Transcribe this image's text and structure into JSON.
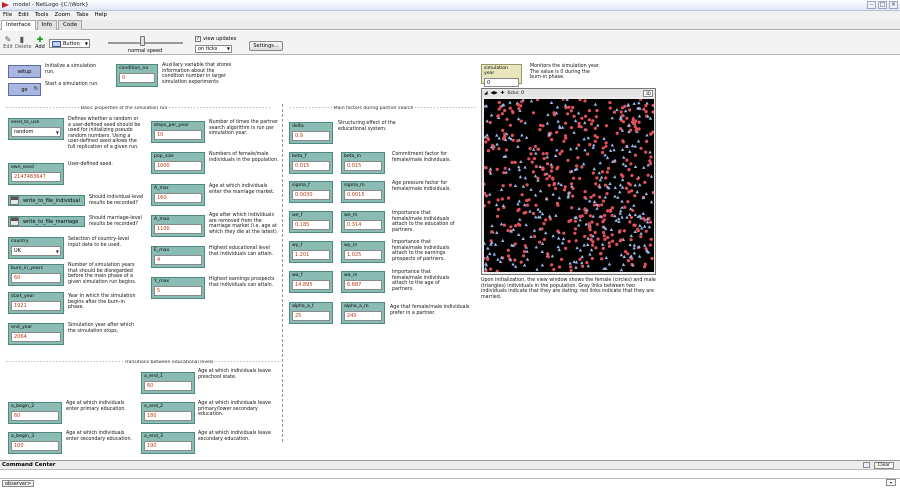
{
  "window": {
    "title": "model - NetLogo {C:\\Work}"
  },
  "menu": [
    "File",
    "Edit",
    "Tools",
    "Zoom",
    "Tabs",
    "Help"
  ],
  "tabs": [
    "Interface",
    "Info",
    "Code"
  ],
  "toolbar": {
    "edit": "Edit",
    "delete": "Delete",
    "add": "Add",
    "widget_type": "Button",
    "speed_label": "normal speed",
    "speed_level": 0.45,
    "view_updates": "view updates",
    "update_mode": "on ticks",
    "settings": "Settings..."
  },
  "buttons": {
    "setup": "setup",
    "go": "go"
  },
  "notes": {
    "setup": "Initialize a simulation run.",
    "go": "Start a simulation run.",
    "condition_no": "Auxiliary variable that stores information about the condition number in larger simulation experiments",
    "seed_to_use": "Defines whether a random or a user-defined seed should be used for initializing pseudo random numbers. Using a user-defined seed allows the full replication of a given run.",
    "own_seed": "User-defined seed.",
    "write_individual": "Should individual-level results be recorded?",
    "write_marriage": "Should marriage-level results be recorded?",
    "country": "Selection of country-level input data to be used.",
    "burn_in_years": "Number of simulation years that should be disregarded before the main phase of a given simulation run begins.",
    "start_year": "Year in which the simulation begins after the burn-in phase.",
    "end_year": "Simulation year after which the simulation stops.",
    "steps_per_year": "Number of times the partner search algorithm is run per simulation year.",
    "pop_size": "Numbers of female/male individuals in the population.",
    "A_mar": "Age at which individuals enter the marriage market.",
    "A_max": "Age after which individuals are removed from the marriage market (i.e. age at which they die at the latest).",
    "E_max": "Highest educational level that individuals can attain.",
    "Y_max": "Highest earnings prospects that individuals can attain.",
    "delta": "Structuring effect of the educational system.",
    "beta": "Commitment factor for female/male individuals.",
    "sigma": "Age pressure factor for female/male individuals.",
    "wa": "Importance that female/male individuals attach to the education of partners.",
    "wy": "Importance that female/male individuals attach to the earnings prospects of partners.",
    "wa2": "Importance that female/male individuals attach to the age of partners.",
    "alpha": "Age that female/male individuals prefer in a partner.",
    "simulation_year": "Monitors the simulation year. The value is 0 during the burn-in phase.",
    "view": "Upon initialization, the view window shows the female (circles) and male (triangles) individuals in the population. Gray links between two individuals indicate that they are dating; red links indicate that they are married.",
    "a_end_1": "Age at which individuals leave preschool state.",
    "a_begin_2": "Age at which individuals enter primary education.",
    "a_end_2": "Age at which individuals leave primary/lower secondary education.",
    "a_begin_3": "Age at which individuals enter secondary education.",
    "a_end_3": "Age at which individuals leave secondary education."
  },
  "sections": {
    "basic": "Basic properties of the simulation run",
    "partner": "Main factors during partner search",
    "transitions": "Transitions between educational levels"
  },
  "widgets": {
    "condition_no": {
      "label": "condition_no",
      "value": "0"
    },
    "seed_to_use": {
      "label": "seed_to_use",
      "value": "random"
    },
    "own_seed": {
      "label": "own_seed",
      "value": "2147483647"
    },
    "write_individual": {
      "label": "write_to_file_individual",
      "on": "On",
      "off": "Off"
    },
    "write_marriage": {
      "label": "write_to_file_marriage",
      "on": "On",
      "off": "Off"
    },
    "country": {
      "label": "country",
      "value": "UK"
    },
    "burn_in_years": {
      "label": "burn_in_years",
      "value": "60"
    },
    "start_year": {
      "label": "start_year",
      "value": "1921"
    },
    "end_year": {
      "label": "end_year",
      "value": "2064"
    },
    "steps_per_year": {
      "label": "steps_per_year",
      "value": "10"
    },
    "pop_size": {
      "label": "pop_size",
      "value": "1000"
    },
    "A_mar": {
      "label": "A_mar",
      "value": "160"
    },
    "A_max": {
      "label": "A_max",
      "value": "1100"
    },
    "E_max": {
      "label": "E_max",
      "value": "4"
    },
    "Y_max": {
      "label": "Y_max",
      "value": "5"
    },
    "delta": {
      "label": "delta",
      "value": "0.9"
    },
    "beta_f": {
      "label": "beta_f",
      "value": "0.015"
    },
    "beta_m": {
      "label": "beta_m",
      "value": "0.015"
    },
    "sigma_f": {
      "label": "sigma_f",
      "value": "0.0030"
    },
    "sigma_m": {
      "label": "sigma_m",
      "value": "0.0015"
    },
    "we_f": {
      "label": "we_f",
      "value": "0.185"
    },
    "we_m": {
      "label": "we_m",
      "value": "0.314"
    },
    "wy_f": {
      "label": "wy_f",
      "value": "1.201"
    },
    "wy_m": {
      "label": "wy_m",
      "value": "1.025"
    },
    "wa_f": {
      "label": "wa_f",
      "value": "14.895"
    },
    "wa_m": {
      "label": "wa_m",
      "value": "6.887"
    },
    "alpha_a_f": {
      "label": "alpha_a_f",
      "value": "25"
    },
    "alpha_a_m": {
      "label": "alpha_a_m",
      "value": "240"
    },
    "simulation_year": {
      "label": "simulation year",
      "value": "0"
    },
    "a_end_1": {
      "label": "a_end_1",
      "value": "60"
    },
    "a_begin_2": {
      "label": "a_begin_2",
      "value": "60"
    },
    "a_end_2": {
      "label": "a_end_2",
      "value": "180"
    },
    "a_begin_3": {
      "label": "a_begin_3",
      "value": "100"
    },
    "a_end_3": {
      "label": "a_end_3",
      "value": "190"
    }
  },
  "view": {
    "ticks_label": "ticks: 0",
    "threed": "3D"
  },
  "command_center": {
    "title": "Command Center",
    "clear": "Clear",
    "observer": "observer>"
  },
  "colors": {
    "button": "#a9b7e0",
    "slider": "#8bbcb4",
    "monitor": "#e8e6bd",
    "female": "#e0505a",
    "male": "#9bb8e6"
  }
}
